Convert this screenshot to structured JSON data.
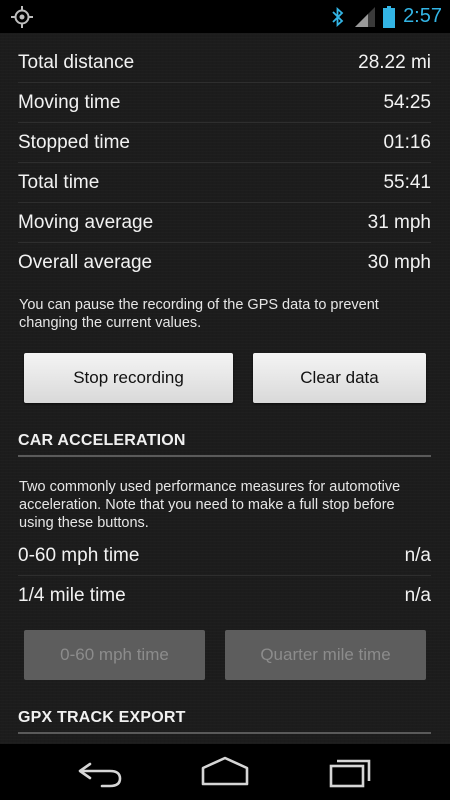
{
  "status_bar": {
    "time": "2:57",
    "icons": [
      "gps-icon",
      "bluetooth-icon",
      "signal-icon",
      "battery-icon"
    ]
  },
  "stats": [
    {
      "label": "Total distance",
      "value": "28.22 mi"
    },
    {
      "label": "Moving time",
      "value": "54:25"
    },
    {
      "label": "Stopped time",
      "value": "01:16"
    },
    {
      "label": "Total time",
      "value": "55:41"
    },
    {
      "label": "Moving average",
      "value": "31 mph"
    },
    {
      "label": "Overall average",
      "value": "30 mph"
    }
  ],
  "recording": {
    "note": "You can pause the recording of the GPS data to prevent changing the current values.",
    "stop_label": "Stop recording",
    "clear_label": "Clear data"
  },
  "acceleration": {
    "header": "CAR ACCELERATION",
    "note": "Two commonly used performance measures for automotive acceleration. Note that you need to make a full stop before using these buttons.",
    "rows": [
      {
        "label": "0-60 mph time",
        "value": "n/a"
      },
      {
        "label": "1/4 mile time",
        "value": "n/a"
      }
    ],
    "btn_060_label": "0-60 mph time",
    "btn_quarter_label": "Quarter mile time"
  },
  "gpx": {
    "header": "GPX TRACK EXPORT"
  },
  "nav_bar": {
    "icons": [
      "back-icon",
      "home-icon",
      "recent-apps-icon"
    ]
  },
  "colors": {
    "accent": "#33b5e5",
    "background": "#1c1c1c",
    "button": "#e6e6e6",
    "button_disabled": "#5d5d5d"
  }
}
